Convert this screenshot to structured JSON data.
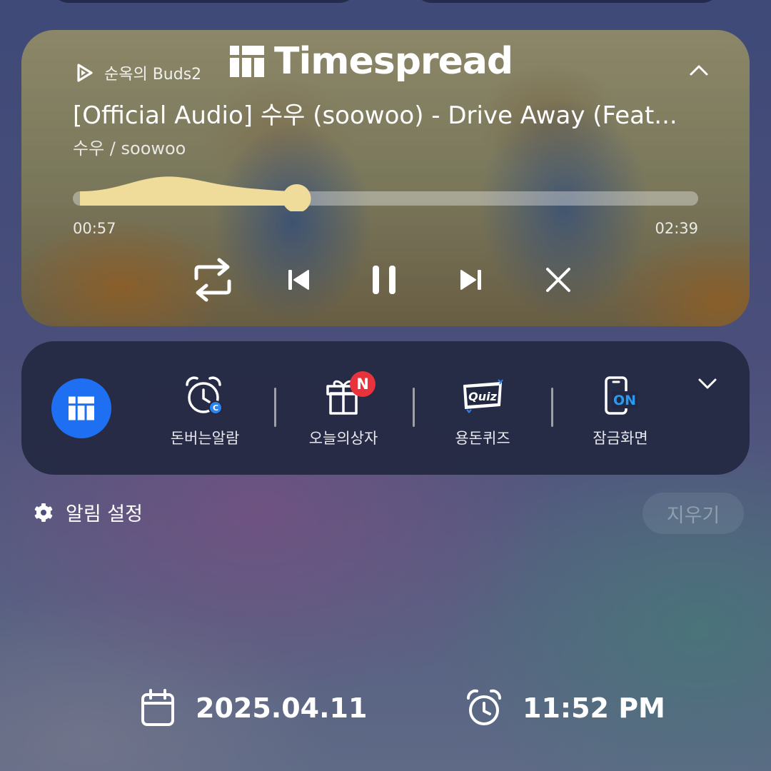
{
  "brand": {
    "wordmark": "Timespread",
    "logo_icon": "timespread-logo-icon"
  },
  "media": {
    "source_icon": "play-outline-icon",
    "source_label": "순옥의 Buds2",
    "title": "[Official Audio] 수우 (soowoo) - Drive Away (Feat...",
    "artist": "수우 / soowoo",
    "elapsed": "00:57",
    "duration": "02:39",
    "progress_fraction": 0.358,
    "progress_color": "#f0dc9a",
    "controls": [
      "repeat-icon",
      "previous-icon",
      "pause-icon",
      "next-icon",
      "close-icon"
    ]
  },
  "shortcuts": {
    "app_icon": "timespread-app-icon",
    "app_color": "#1f6ff2",
    "items": [
      {
        "label": "돈버는알람",
        "icon": "alarm-coin-icon"
      },
      {
        "label": "오늘의상자",
        "icon": "gift-box-icon",
        "badge": "N"
      },
      {
        "label": "용돈퀴즈",
        "icon": "quiz-icon",
        "icon_text": "Quiz"
      },
      {
        "label": "잠금화면",
        "icon": "lockscreen-on-icon",
        "icon_text": "ON"
      }
    ]
  },
  "notification_bar": {
    "settings_label": "알림 설정",
    "clear_label": "지우기"
  },
  "footer": {
    "date": "2025.04.11",
    "time": "11:52 PM"
  }
}
